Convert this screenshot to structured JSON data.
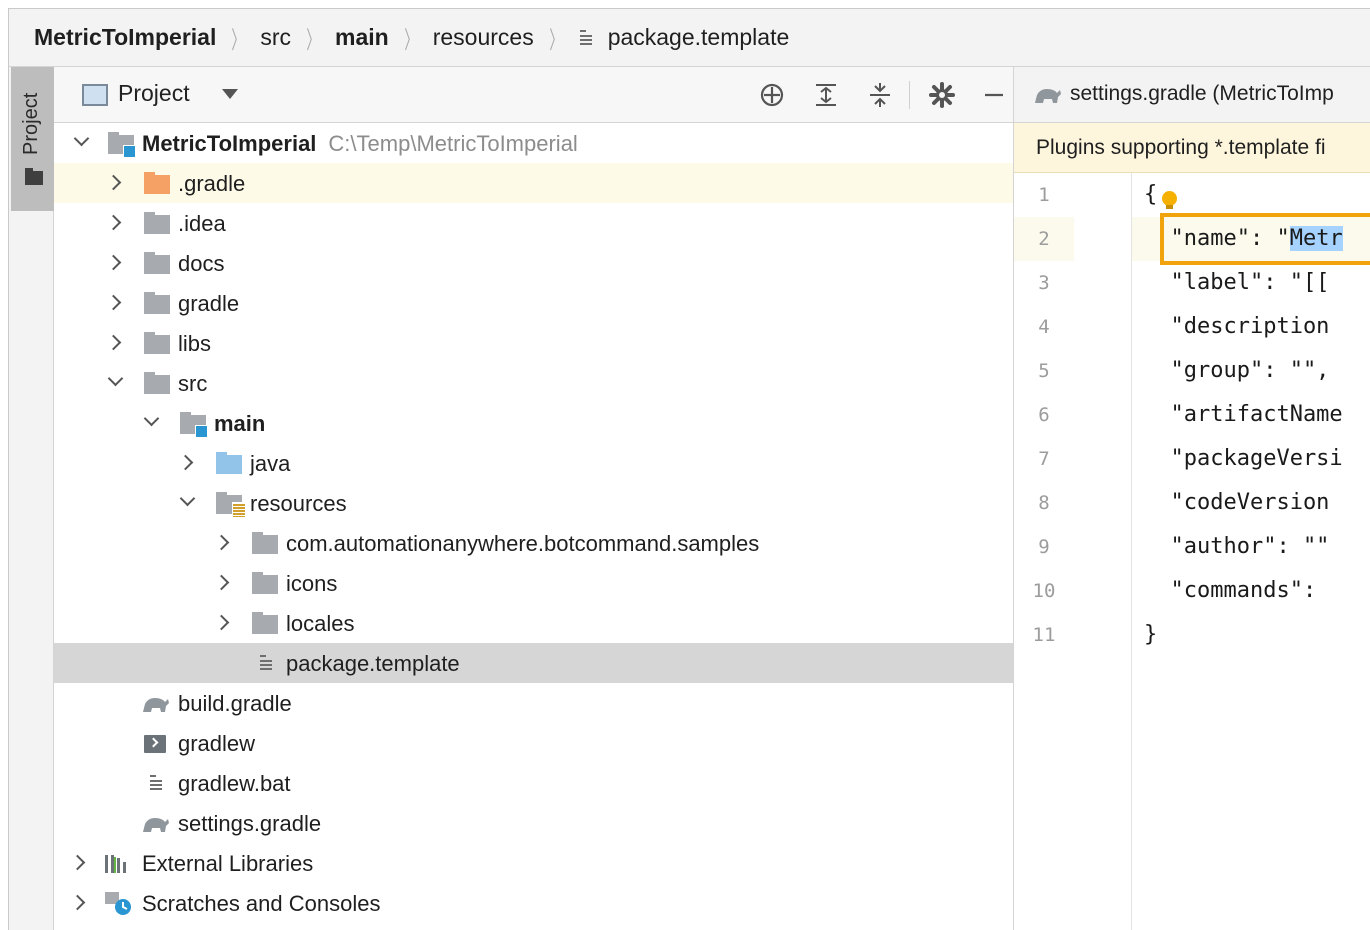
{
  "breadcrumb": {
    "items": [
      {
        "label": "MetricToImperial",
        "bold": true
      },
      {
        "label": "src",
        "bold": false
      },
      {
        "label": "main",
        "bold": true
      },
      {
        "label": "resources",
        "bold": false
      },
      {
        "label": "package.template",
        "bold": false
      }
    ]
  },
  "stripe": {
    "label": "Project"
  },
  "project_panel": {
    "title": "Project",
    "tree": [
      {
        "label": "MetricToImperial",
        "path": "C:\\Temp\\MetricToImperial"
      },
      {
        "label": ".gradle"
      },
      {
        "label": ".idea"
      },
      {
        "label": "docs"
      },
      {
        "label": "gradle"
      },
      {
        "label": "libs"
      },
      {
        "label": "src"
      },
      {
        "label": "main"
      },
      {
        "label": "java"
      },
      {
        "label": "resources"
      },
      {
        "label": "com.automationanywhere.botcommand.samples"
      },
      {
        "label": "icons"
      },
      {
        "label": "locales"
      },
      {
        "label": "package.template"
      },
      {
        "label": "build.gradle"
      },
      {
        "label": "gradlew"
      },
      {
        "label": "gradlew.bat"
      },
      {
        "label": "settings.gradle"
      },
      {
        "label": "External Libraries"
      },
      {
        "label": "Scratches and Consoles"
      }
    ]
  },
  "editor": {
    "tab_label": "settings.gradle (MetricToImp",
    "banner": "Plugins supporting *.template fi",
    "lines": [
      {
        "num": "1",
        "text": "{"
      },
      {
        "num": "2",
        "text_pre": "  \"name\": \"",
        "text_sel": "Metr"
      },
      {
        "num": "3",
        "text": "  \"label\": \"[["
      },
      {
        "num": "4",
        "text": "  \"description"
      },
      {
        "num": "5",
        "text": "  \"group\": \"\","
      },
      {
        "num": "6",
        "text": "  \"artifactName"
      },
      {
        "num": "7",
        "text": "  \"packageVersi"
      },
      {
        "num": "8",
        "text": "  \"codeVersion"
      },
      {
        "num": "9",
        "text": "  \"author\": \"\""
      },
      {
        "num": "10",
        "text": "  \"commands\":"
      },
      {
        "num": "11",
        "text": "}"
      }
    ]
  },
  "colors": {
    "highlight_box": "#f0a30a",
    "selection": "#a6d2ff",
    "selected_row": "#d6d6d6",
    "gradle_row": "#fdfbe7",
    "module_badge": "#2996d1"
  }
}
